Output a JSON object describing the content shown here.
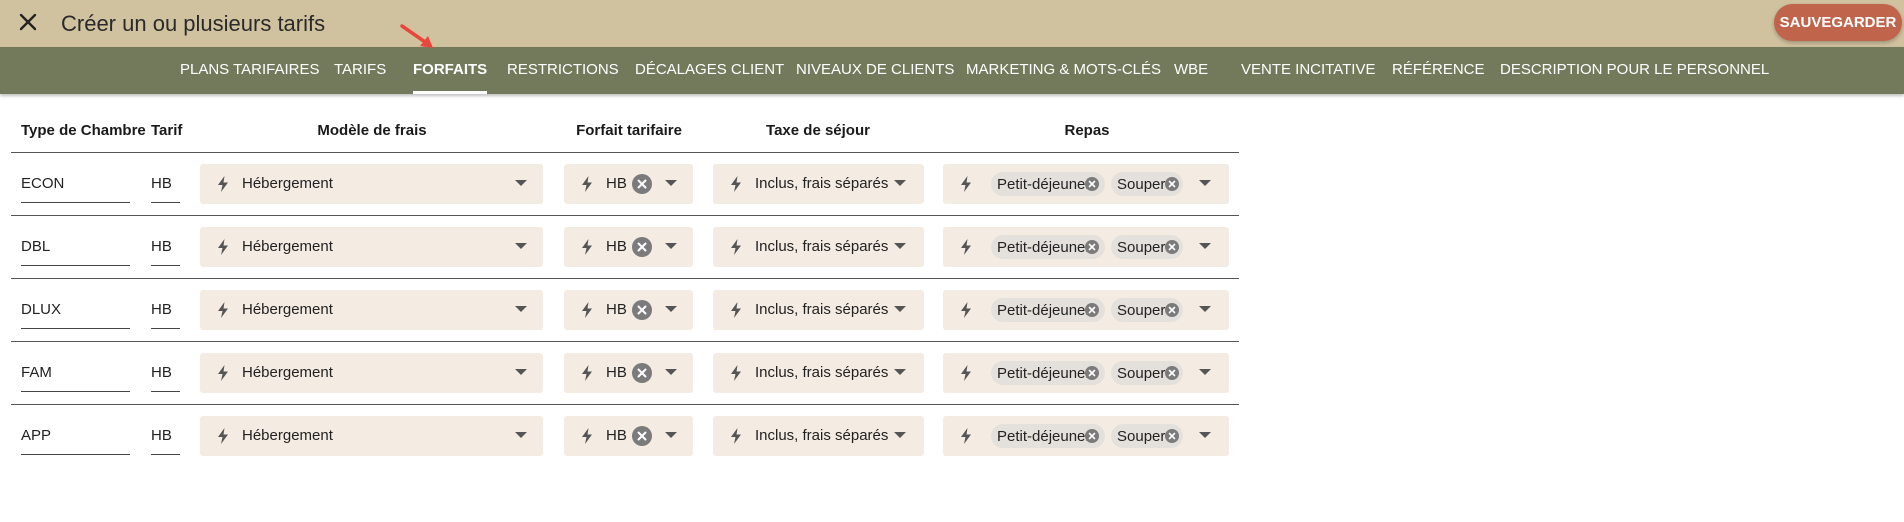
{
  "header": {
    "title": "Créer un ou plusieurs tarifs",
    "save_label": "SAUVEGARDER"
  },
  "colors": {
    "topbar": "#d1c29f",
    "tabbar": "#727a5b",
    "accent": "#c0654b",
    "field_bg": "#f4ebe2"
  },
  "tabs": [
    {
      "label": "PLANS TARIFAIRES",
      "active": false
    },
    {
      "label": "TARIFS",
      "active": false
    },
    {
      "label": "FORFAITS",
      "active": true
    },
    {
      "label": "RESTRICTIONS",
      "active": false
    },
    {
      "label": "DÉCALAGES CLIENT",
      "active": false
    },
    {
      "label": "NIVEAUX DE CLIENTS",
      "active": false
    },
    {
      "label": "MARKETING & MOTS-CLÉS",
      "active": false
    },
    {
      "label": "WBE",
      "active": false
    },
    {
      "label": "VENTE INCITATIVE",
      "active": false
    },
    {
      "label": "RÉFÉRENCE",
      "active": false
    },
    {
      "label": "DESCRIPTION POUR LE PERSONNEL",
      "active": false
    }
  ],
  "table": {
    "columns": [
      "Type de Chambre",
      "Tarif",
      "Modèle de frais",
      "Forfait tarifaire",
      "Taxe de séjour",
      "Repas"
    ],
    "rows": [
      {
        "room": "ECON",
        "rate": "HB",
        "fee_model": "Hébergement",
        "package": "HB",
        "tax": "Inclus, frais séparés",
        "meals": [
          "Petit-déjeuner",
          "Souper"
        ]
      },
      {
        "room": "DBL",
        "rate": "HB",
        "fee_model": "Hébergement",
        "package": "HB",
        "tax": "Inclus, frais séparés",
        "meals": [
          "Petit-déjeuner",
          "Souper"
        ]
      },
      {
        "room": "DLUX",
        "rate": "HB",
        "fee_model": "Hébergement",
        "package": "HB",
        "tax": "Inclus, frais séparés",
        "meals": [
          "Petit-déjeuner",
          "Souper"
        ]
      },
      {
        "room": "FAM",
        "rate": "HB",
        "fee_model": "Hébergement",
        "package": "HB",
        "tax": "Inclus, frais séparés",
        "meals": [
          "Petit-déjeuner",
          "Souper"
        ]
      },
      {
        "room": "APP",
        "rate": "HB",
        "fee_model": "Hébergement",
        "package": "HB",
        "tax": "Inclus, frais séparés",
        "meals": [
          "Petit-déjeuner",
          "Souper"
        ]
      }
    ]
  },
  "icons": {
    "close": "close-icon",
    "bolt": "bolt-icon",
    "caret": "chevron-down-icon",
    "clear": "clear-circle-icon",
    "pointer": "red-arrow-icon"
  }
}
